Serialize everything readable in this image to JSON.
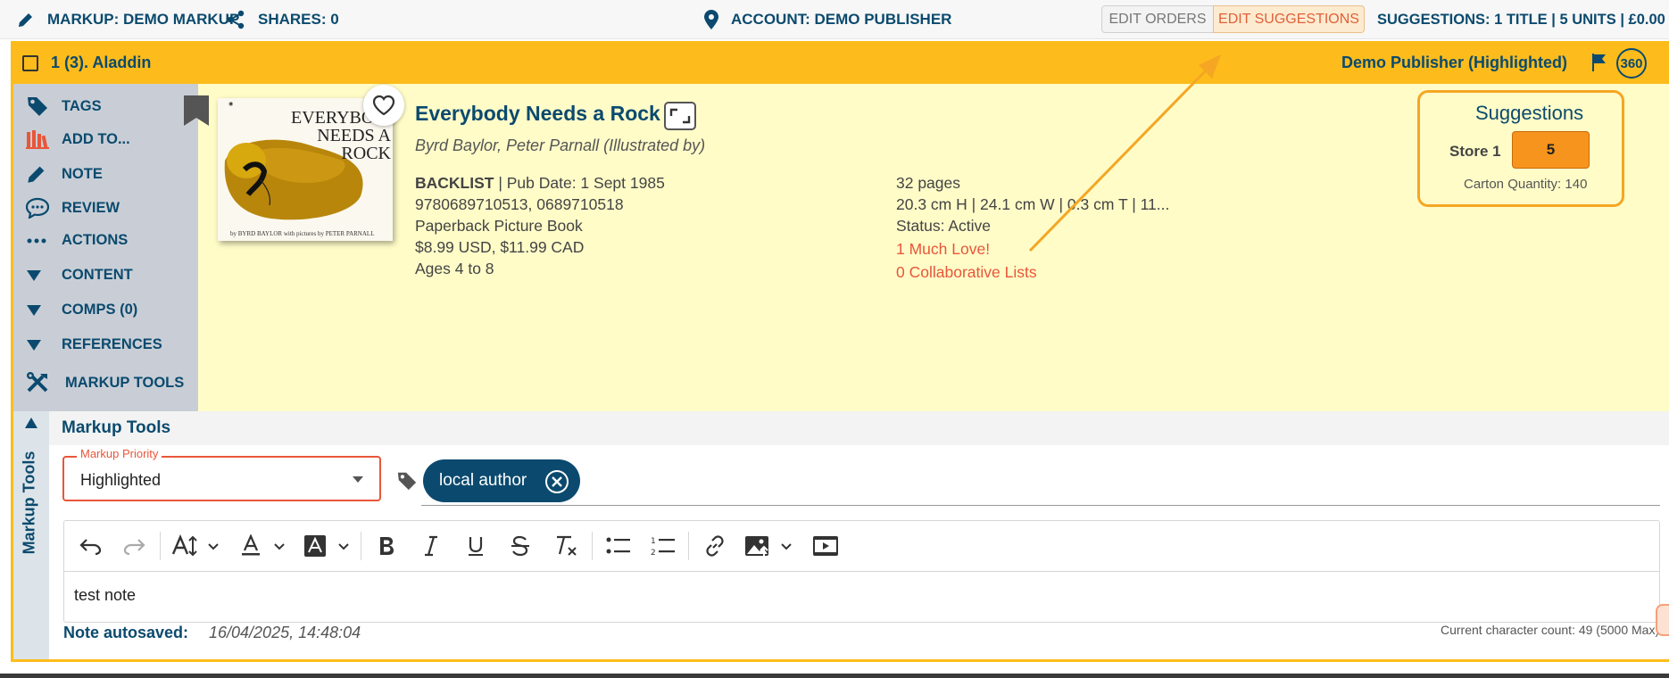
{
  "topbar": {
    "markup_label": "MARKUP: DEMO MARKUP",
    "shares_label": "SHARES: 0",
    "account_label": "ACCOUNT: DEMO PUBLISHER",
    "edit_orders": "EDIT ORDERS",
    "edit_suggestions": "EDIT SUGGESTIONS",
    "suggestions_summary": "SUGGESTIONS: 1 TITLE | 5 UNITS | £0.00"
  },
  "titlebar": {
    "item_label": "1 (3). Aladdin",
    "publisher_label": "Demo Publisher (Highlighted)",
    "badge_360": "360"
  },
  "sidebar": {
    "items": [
      {
        "label": "TAGS",
        "icon": "tag-icon"
      },
      {
        "label": "ADD TO...",
        "icon": "books-icon"
      },
      {
        "label": "NOTE",
        "icon": "pencil-icon"
      },
      {
        "label": "REVIEW",
        "icon": "speech-bubble-icon"
      },
      {
        "label": "ACTIONS",
        "icon": "ellipsis-icon"
      },
      {
        "label": "CONTENT",
        "icon": "caret-down-icon"
      },
      {
        "label": "COMPS (0)",
        "icon": "caret-down-icon"
      },
      {
        "label": "REFERENCES",
        "icon": "caret-down-icon"
      },
      {
        "label": "MARKUP TOOLS",
        "icon": "tools-icon"
      }
    ]
  },
  "book": {
    "cover_title": "EVERYBODY NEEDS A ROCK",
    "cover_credit": "by BYRD BAYLOR with pictures by PETER PARNALL",
    "title": "Everybody Needs a Rock",
    "authors": "Byrd Baylor, Peter Parnall (Illustrated by)",
    "status_tag": "BACKLIST",
    "pub_date": " | Pub Date: 1 Sept 1985",
    "isbns": "9780689710513, 0689710518",
    "format": "Paperback Picture Book",
    "price": "$8.99 USD, $11.99 CAD",
    "ages": "Ages 4 to 8",
    "pages": "32 pages",
    "dimensions": "20.3 cm H | 24.1 cm W | 0.3 cm T | 11...",
    "status": "Status: Active",
    "loves": "1 Much Love!",
    "collab_lists": "0 Collaborative Lists"
  },
  "suggestions": {
    "heading": "Suggestions",
    "store_label": "Store 1",
    "store_qty": "5",
    "carton": "Carton Quantity: 140"
  },
  "markup_tools": {
    "side_label": "Markup Tools",
    "heading": "Markup Tools",
    "priority_label": "Markup Priority",
    "priority_value": "Highlighted",
    "tag_chip": "local author",
    "note_text": "test note",
    "autosaved_label": "Note autosaved:",
    "autosaved_time": "16/04/2025, 14:48:04",
    "char_count": "Current character count: 49 (5000 Max)"
  },
  "colors": {
    "accent_yellow": "#fdbc1b",
    "highlight_bg": "#fffcc8",
    "navy": "#0b4a6e",
    "orange": "#f7941d",
    "link_orange": "#e8563a",
    "sidebar_gray": "#c9ced6"
  }
}
